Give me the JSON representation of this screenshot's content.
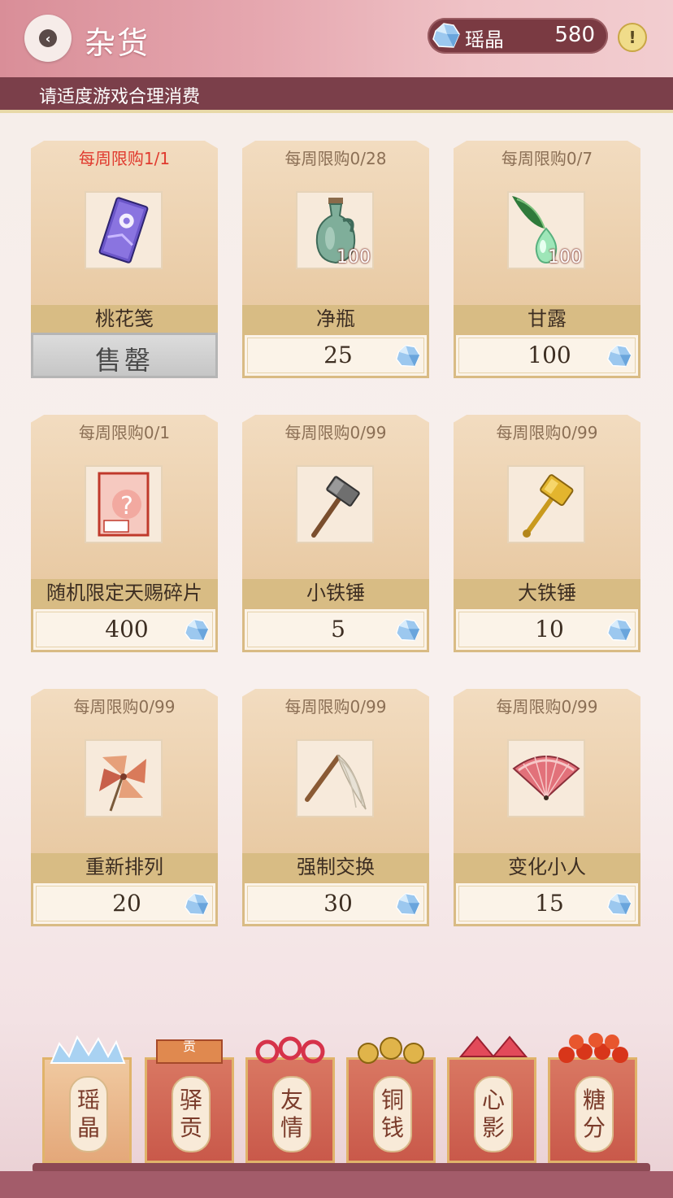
{
  "header": {
    "title": "杂货",
    "currency_label": "瑶晶",
    "currency_amount": "580",
    "info_symbol": "!"
  },
  "notice": "请适度游戏合理消费",
  "items": [
    {
      "limit": "每周限购1/1",
      "name": "桃花笺",
      "status": "售罄",
      "icon": "peach-blossom-card-icon"
    },
    {
      "limit": "每周限购0/28",
      "name": "净瓶",
      "price": "25",
      "qty": "100",
      "icon": "vase-icon"
    },
    {
      "limit": "每周限购0/7",
      "name": "甘露",
      "price": "100",
      "qty": "100",
      "icon": "dew-drop-icon"
    },
    {
      "limit": "每周限购0/1",
      "name": "随机限定天赐碎片",
      "price": "400",
      "icon": "fragment-card-icon"
    },
    {
      "limit": "每周限购0/99",
      "name": "小铁锤",
      "price": "5",
      "icon": "small-hammer-icon"
    },
    {
      "limit": "每周限购0/99",
      "name": "大铁锤",
      "price": "10",
      "icon": "big-hammer-icon"
    },
    {
      "limit": "每周限购0/99",
      "name": "重新排列",
      "price": "20",
      "icon": "pinwheel-icon"
    },
    {
      "limit": "每周限购0/99",
      "name": "强制交换",
      "price": "30",
      "icon": "whisk-icon"
    },
    {
      "limit": "每周限购0/99",
      "name": "变化小人",
      "price": "15",
      "icon": "fan-icon"
    }
  ],
  "tabs": [
    {
      "c1": "瑶",
      "c2": "晶",
      "active": true
    },
    {
      "c1": "驿",
      "c2": "贡"
    },
    {
      "c1": "友",
      "c2": "情"
    },
    {
      "c1": "铜",
      "c2": "钱"
    },
    {
      "c1": "心",
      "c2": "影"
    },
    {
      "c1": "糖",
      "c2": "分"
    }
  ],
  "tab_crown_text": "贡",
  "colors": {
    "header_gradient_start": "#d98e98",
    "notice_bar": "#7b3f4a",
    "limit_red": "#e03a2e",
    "card_panel": "#e7c79f"
  }
}
